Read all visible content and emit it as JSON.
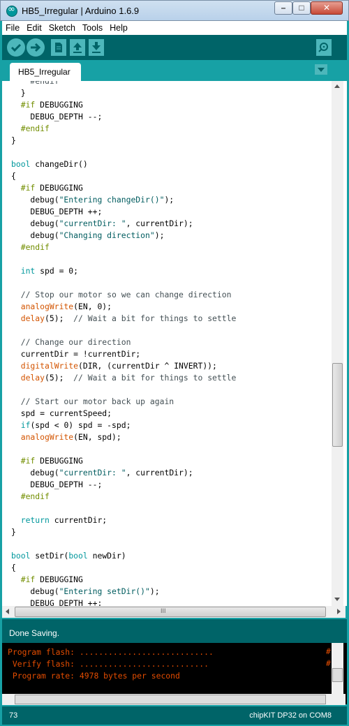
{
  "window": {
    "title": "HB5_Irregular | Arduino 1.6.9"
  },
  "menu": [
    "File",
    "Edit",
    "Sketch",
    "Tools",
    "Help"
  ],
  "toolbar": {
    "verify_icon": "check-icon",
    "upload_icon": "arrow-right-icon",
    "new_icon": "new-file-icon",
    "open_icon": "open-arrow-up-icon",
    "save_icon": "save-arrow-down-icon",
    "serial_monitor_icon": "magnifier-icon"
  },
  "tab": {
    "label": "HB5_Irregular"
  },
  "code_lines": [
    [
      [
        "c",
        "    #endif"
      ]
    ],
    [
      [
        "n",
        "  }"
      ]
    ],
    [
      [
        "p",
        "  #if"
      ],
      [
        "n",
        " DEBUGGING"
      ]
    ],
    [
      [
        "n",
        "    DEBUG_DEPTH --;"
      ]
    ],
    [
      [
        "p",
        "  #endif"
      ]
    ],
    [
      [
        "n",
        "}"
      ]
    ],
    [],
    [
      [
        "k",
        "bool"
      ],
      [
        "n",
        " changeDir()"
      ]
    ],
    [
      [
        "n",
        "{"
      ]
    ],
    [
      [
        "p",
        "  #if"
      ],
      [
        "n",
        " DEBUGGING"
      ]
    ],
    [
      [
        "n",
        "    debug("
      ],
      [
        "s",
        "\"Entering changeDir()\""
      ],
      [
        "n",
        ");"
      ]
    ],
    [
      [
        "n",
        "    DEBUG_DEPTH ++;"
      ]
    ],
    [
      [
        "n",
        "    debug("
      ],
      [
        "s",
        "\"currentDir: \""
      ],
      [
        "n",
        ", currentDir);"
      ]
    ],
    [
      [
        "n",
        "    debug("
      ],
      [
        "s",
        "\"Changing direction\""
      ],
      [
        "n",
        ");"
      ]
    ],
    [
      [
        "p",
        "  #endif"
      ]
    ],
    [],
    [
      [
        "k",
        "  int"
      ],
      [
        "n",
        " spd = 0;"
      ]
    ],
    [],
    [
      [
        "c",
        "  // Stop our motor so we can change direction"
      ]
    ],
    [
      [
        "f",
        "  analogWrite"
      ],
      [
        "n",
        "(EN, 0);"
      ]
    ],
    [
      [
        "f",
        "  delay"
      ],
      [
        "n",
        "(5);  "
      ],
      [
        "c",
        "// Wait a bit for things to settle"
      ]
    ],
    [],
    [
      [
        "c",
        "  // Change our direction"
      ]
    ],
    [
      [
        "n",
        "  currentDir = !currentDir;"
      ]
    ],
    [
      [
        "f",
        "  digitalWrite"
      ],
      [
        "n",
        "(DIR, (currentDir ^ INVERT));"
      ]
    ],
    [
      [
        "f",
        "  delay"
      ],
      [
        "n",
        "(5);  "
      ],
      [
        "c",
        "// Wait a bit for things to settle"
      ]
    ],
    [],
    [
      [
        "c",
        "  // Start our motor back up again"
      ]
    ],
    [
      [
        "n",
        "  spd = currentSpeed;"
      ]
    ],
    [
      [
        "k",
        "  if"
      ],
      [
        "n",
        "(spd < 0) spd = -spd;"
      ]
    ],
    [
      [
        "f",
        "  analogWrite"
      ],
      [
        "n",
        "(EN, spd);"
      ]
    ],
    [],
    [
      [
        "p",
        "  #if"
      ],
      [
        "n",
        " DEBUGGING"
      ]
    ],
    [
      [
        "n",
        "    debug("
      ],
      [
        "s",
        "\"currentDir: \""
      ],
      [
        "n",
        ", currentDir);"
      ]
    ],
    [
      [
        "n",
        "    DEBUG_DEPTH --;"
      ]
    ],
    [
      [
        "p",
        "  #endif"
      ]
    ],
    [],
    [
      [
        "k",
        "  return"
      ],
      [
        "n",
        " currentDir;"
      ]
    ],
    [
      [
        "n",
        "}"
      ]
    ],
    [],
    [
      [
        "k",
        "bool"
      ],
      [
        "n",
        " setDir("
      ],
      [
        "k",
        "bool"
      ],
      [
        "n",
        " newDir)"
      ]
    ],
    [
      [
        "n",
        "{"
      ]
    ],
    [
      [
        "p",
        "  #if"
      ],
      [
        "n",
        " DEBUGGING"
      ]
    ],
    [
      [
        "n",
        "    debug("
      ],
      [
        "s",
        "\"Entering setDir()\""
      ],
      [
        "n",
        ");"
      ]
    ],
    [
      [
        "n",
        "    DEBUG_DEPTH ++;"
      ]
    ]
  ],
  "status": {
    "message": "Done Saving."
  },
  "console": {
    "lines": [
      "Program flash: ............................",
      " Verify flash: ...........................",
      " Program rate: 4978 bytes per second"
    ],
    "hash": "#"
  },
  "footer": {
    "line_number": "73",
    "board": "chipKIT DP32 on COM8"
  },
  "scrollbar": {
    "scroll_glyph": "III"
  },
  "colors": {
    "arduino_teal": "#00979c",
    "dark_teal": "#006468",
    "console_text": "#e34c00"
  }
}
